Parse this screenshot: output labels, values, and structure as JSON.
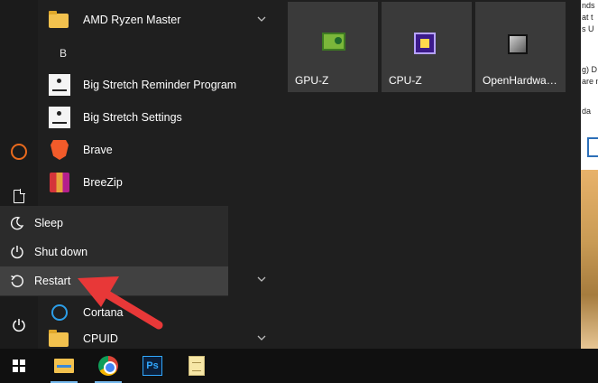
{
  "app_list": {
    "items": [
      {
        "label": "AMD Ryzen Master",
        "icon": "folder-icon",
        "expandable": true
      },
      {
        "label": "Big Stretch Reminder Program",
        "icon": "big-stretch-icon",
        "expandable": false
      },
      {
        "label": "Big Stretch Settings",
        "icon": "big-stretch-icon",
        "expandable": false
      },
      {
        "label": "Brave",
        "icon": "brave-icon",
        "expandable": false
      },
      {
        "label": "BreeZip",
        "icon": "breezip-icon",
        "expandable": false
      },
      {
        "label": "Cortana",
        "icon": "cortana-icon",
        "expandable": false
      },
      {
        "label": "CPUID",
        "icon": "folder-icon",
        "expandable": true
      }
    ],
    "section_letter": "B"
  },
  "power_menu": {
    "items": [
      {
        "label": "Sleep",
        "icon": "moon-icon"
      },
      {
        "label": "Shut down",
        "icon": "power-icon"
      },
      {
        "label": "Restart",
        "icon": "restart-icon",
        "highlighted": true
      }
    ]
  },
  "tiles": [
    {
      "label": "GPU-Z",
      "icon": "gpu-z-icon"
    },
    {
      "label": "CPU-Z",
      "icon": "cpu-z-icon"
    },
    {
      "label": "OpenHardwa…",
      "icon": "open-hardware-monitor-icon"
    }
  ],
  "taskbar": {
    "items": [
      "windows-start-icon",
      "file-explorer-icon",
      "chrome-icon",
      "photoshop-icon",
      "notepad-icon"
    ],
    "ps_label": "Ps"
  },
  "background_window": {
    "text_lines": [
      "nds",
      "at t",
      "s U",
      "g) D",
      "are n",
      "da"
    ]
  },
  "colors": {
    "menu_bg": "#1f1f1f",
    "power_menu_bg": "#2b2b2b",
    "highlight_bg": "#414141",
    "tile_bg": "#3a3a3a",
    "annotation_red": "#e83838"
  }
}
